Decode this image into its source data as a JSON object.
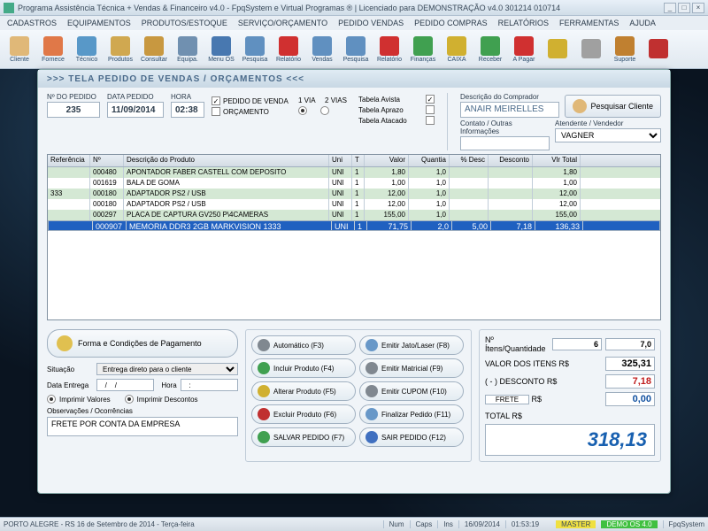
{
  "title": "Programa Assistência Técnica + Vendas & Financeiro v4.0 - FpqSystem e Virtual Programas ® | Licenciado para  DEMONSTRAÇÃO v4.0 301214 010714",
  "menu": [
    "CADASTROS",
    "EQUIPAMENTOS",
    "PRODUTOS/ESTOQUE",
    "SERVIÇO/ORÇAMENTO",
    "PEDIDO VENDAS",
    "PEDIDO COMPRAS",
    "RELATÓRIOS",
    "FERRAMENTAS",
    "AJUDA"
  ],
  "toolbar": [
    {
      "label": "Cliente",
      "color": "#e0b878"
    },
    {
      "label": "Fornece",
      "color": "#e07848"
    },
    {
      "label": "Técnico",
      "color": "#5898c8"
    },
    {
      "label": "Produtos",
      "color": "#d0a850"
    },
    {
      "label": "Consultar",
      "color": "#c89840"
    },
    {
      "label": "Equipa.",
      "color": "#7090b0"
    },
    {
      "label": "Menu OS",
      "color": "#4878b0"
    },
    {
      "label": "Pesquisa",
      "color": "#6090c0"
    },
    {
      "label": "Relatório",
      "color": "#d03030"
    },
    {
      "label": "Vendas",
      "color": "#6090c0"
    },
    {
      "label": "Pesquisa",
      "color": "#6090c0"
    },
    {
      "label": "Relatório",
      "color": "#d03030"
    },
    {
      "label": "Finanças",
      "color": "#40a050"
    },
    {
      "label": "CAIXA",
      "color": "#d0b030"
    },
    {
      "label": "Receber",
      "color": "#40a050"
    },
    {
      "label": "A Pagar",
      "color": "#d03030"
    },
    {
      "label": "",
      "color": "#d0b030"
    },
    {
      "label": "",
      "color": "#a0a0a0"
    },
    {
      "label": "Suporte",
      "color": "#c08030"
    },
    {
      "label": "",
      "color": "#c03030"
    }
  ],
  "panel_title": ">>>   TELA PEDIDO DE VENDAS / ORÇAMENTOS   <<<",
  "order": {
    "num_label": "Nº DO PEDIDO",
    "num": "235",
    "date_label": "DATA PEDIDO",
    "date": "11/09/2014",
    "time_label": "HORA",
    "time": "02:38",
    "chk_venda": "PEDIDO DE VENDA",
    "chk_orc": "ORÇAMENTO",
    "via1": "1 VIA",
    "via2": "2 VIAS",
    "tbl_avista": "Tabela Avista",
    "tbl_aprazo": "Tabela Aprazo",
    "tbl_atacado": "Tabela Atacado"
  },
  "buyer": {
    "desc_label": "Descrição do Comprador",
    "name": "ANAIR MEIRELLES",
    "contact_label": "Contato / Outras Informações",
    "pesq": "Pesquisar Cliente",
    "vend_label": "Atendente / Vendedor",
    "vend": "VAGNER"
  },
  "grid": {
    "headers": [
      "Referência",
      "Nº",
      "Descrição do Produto",
      "Uni",
      "T",
      "Valor",
      "Quantia",
      "% Desc",
      "Desconto",
      "Vlr Total"
    ],
    "rows": [
      {
        "ref": "",
        "num": "000480",
        "desc": "APONTADOR FABER CASTELL COM DEPOSITO",
        "uni": "UNI",
        "t": "1",
        "val": "1,80",
        "qt": "1,0",
        "pd": "",
        "d": "",
        "tot": "1,80"
      },
      {
        "ref": "",
        "num": "001619",
        "desc": "BALA DE GOMA",
        "uni": "UNI",
        "t": "1",
        "val": "1,00",
        "qt": "1,0",
        "pd": "",
        "d": "",
        "tot": "1,00"
      },
      {
        "ref": "333",
        "num": "000180",
        "desc": "ADAPTADOR PS2 / USB",
        "uni": "UNI",
        "t": "1",
        "val": "12,00",
        "qt": "1,0",
        "pd": "",
        "d": "",
        "tot": "12,00"
      },
      {
        "ref": "",
        "num": "000180",
        "desc": "ADAPTADOR PS2 / USB",
        "uni": "UNI",
        "t": "1",
        "val": "12,00",
        "qt": "1,0",
        "pd": "",
        "d": "",
        "tot": "12,00"
      },
      {
        "ref": "",
        "num": "000297",
        "desc": "PLACA DE CAPTURA GV250 P\\4CAMERAS",
        "uni": "UNI",
        "t": "1",
        "val": "155,00",
        "qt": "1,0",
        "pd": "",
        "d": "",
        "tot": "155,00"
      },
      {
        "ref": "",
        "num": "000907",
        "desc": "MEMORIA DDR3 2GB MARKVISION 1333",
        "uni": "UNI",
        "t": "1",
        "val": "71,75",
        "qt": "2,0",
        "pd": "5,00",
        "d": "7,18",
        "tot": "136,33",
        "sel": true
      }
    ]
  },
  "left": {
    "pagto": "Forma e Condições de Pagamento",
    "sit_label": "Situação",
    "sit": "Entrega direto para o cliente",
    "ent_label": "Data Entrega",
    "ent": "   /    /",
    "hora_label": "Hora",
    "hora": "   :",
    "impval": "Imprimir Valores",
    "impdesc": "Imprimir Descontos",
    "obs_label": "Observações / Ocorrências",
    "obs": "FRETE POR CONTA DA EMPRESA"
  },
  "actions": [
    {
      "l": "Automático    (F3)",
      "c": "#808890"
    },
    {
      "l": "Emitir Jato/Laser (F8)",
      "c": "#6898c8"
    },
    {
      "l": "Incluir Produto  (F4)",
      "c": "#40a050"
    },
    {
      "l": "Emitir Matricial   (F9)",
      "c": "#808890"
    },
    {
      "l": "Alterar Produto  (F5)",
      "c": "#d0b030"
    },
    {
      "l": "Emitir CUPOM   (F10)",
      "c": "#808890"
    },
    {
      "l": "Excluir Produto  (F6)",
      "c": "#c03030"
    },
    {
      "l": "Finalizar Pedido  (F11)",
      "c": "#6898c8"
    },
    {
      "l": "SALVAR PEDIDO (F7)",
      "c": "#40a050"
    },
    {
      "l": "SAIR  PEDIDO  (F12)",
      "c": "#4070c0"
    }
  ],
  "totals": {
    "qt_label": "Nº Ítens/Quantidade",
    "qt_n": "6",
    "qt_v": "7,0",
    "itens_label": "VALOR DOS ITENS R$",
    "itens": "325,31",
    "desc_label": "( - ) DESCONTO R$",
    "desc": "7,18",
    "frete_label": "FRETE",
    "rs": "R$",
    "frete": "0,00",
    "total_label": "TOTAL R$",
    "total": "318,13"
  },
  "status": {
    "loc": "PORTO ALEGRE - RS 16 de Setembro de 2014 - Terça-feira",
    "num": "Num",
    "caps": "Caps",
    "ins": "Ins",
    "date": "16/09/2014",
    "time": "01:53:19",
    "master": "MASTER",
    "demo": "DEMO OS 4.0",
    "app": "FpqSystem"
  }
}
